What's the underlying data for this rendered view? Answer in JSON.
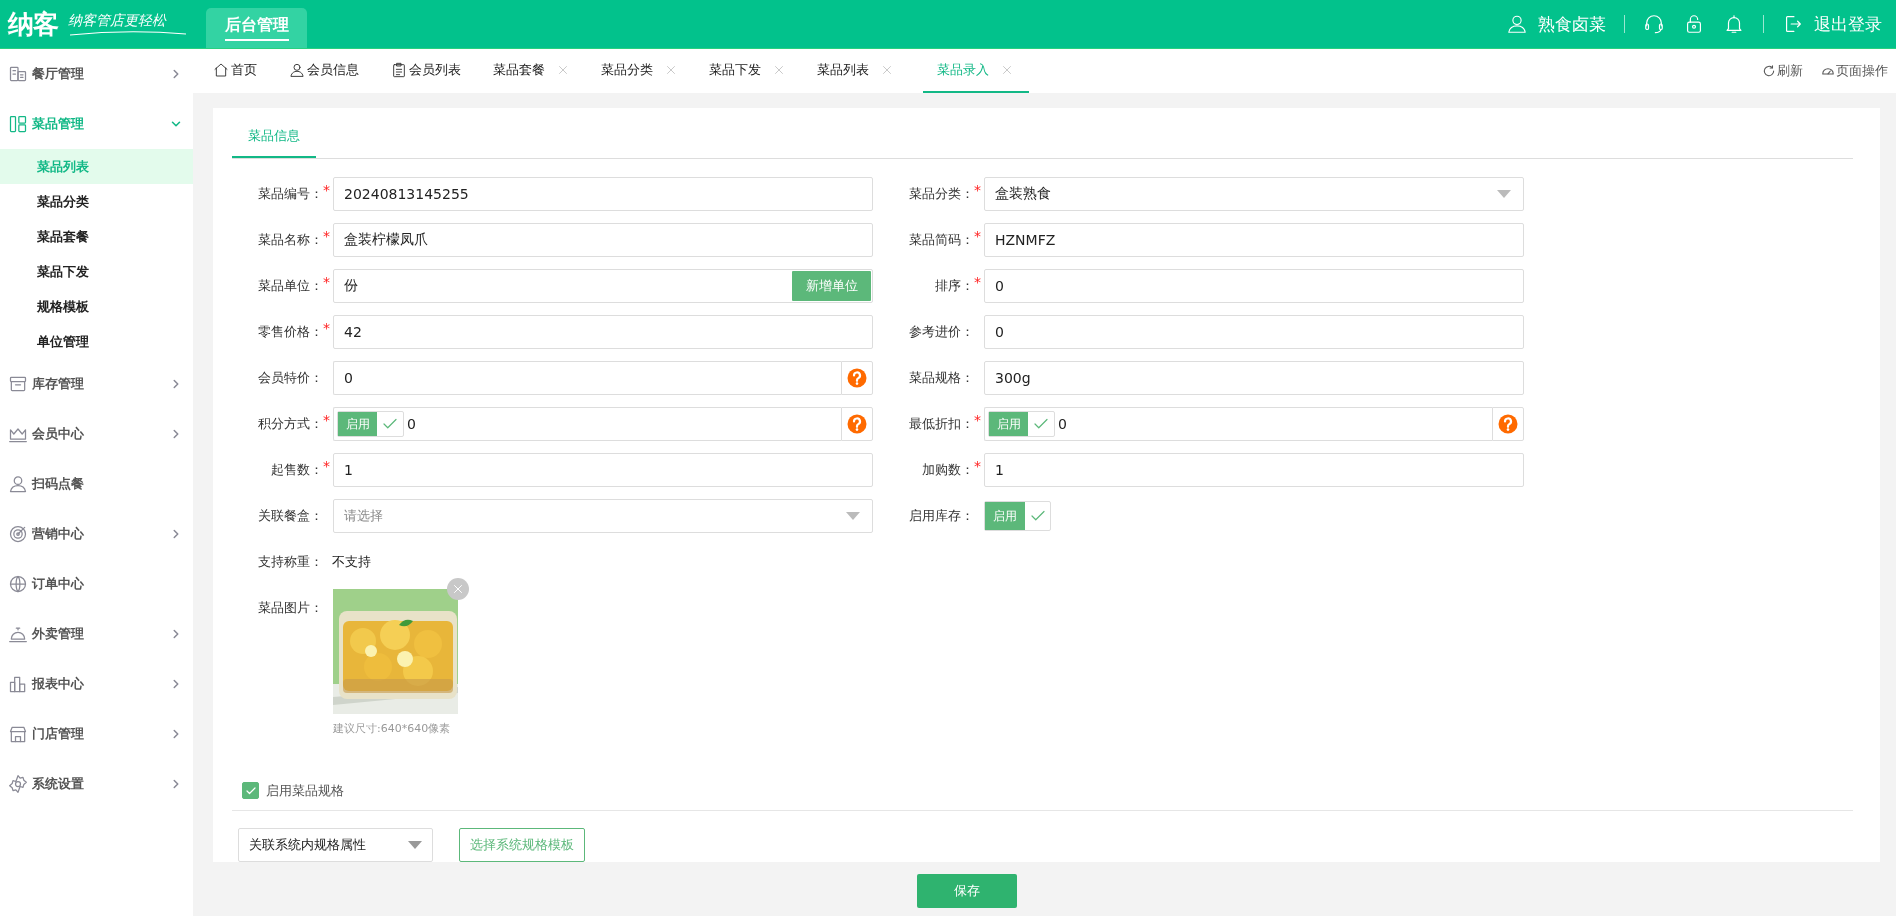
{
  "header": {
    "logo": "纳客",
    "slogan": "纳客管店更轻松",
    "module_tab": {
      "label": "后台管理",
      "selected": true
    },
    "user": "熟食卤菜",
    "logout": "退出登录"
  },
  "sidebar": {
    "items": [
      {
        "label": "餐厅管理",
        "expandable": true,
        "expanded": false
      },
      {
        "label": "菜品管理",
        "expandable": true,
        "expanded": true,
        "children": [
          {
            "label": "菜品列表",
            "selected": true
          },
          {
            "label": "菜品分类",
            "selected": false
          },
          {
            "label": "菜品套餐",
            "selected": false
          },
          {
            "label": "菜品下发",
            "selected": false
          },
          {
            "label": "规格模板",
            "selected": false
          },
          {
            "label": "单位管理",
            "selected": false
          }
        ]
      },
      {
        "label": "库存管理",
        "expandable": true,
        "expanded": false
      },
      {
        "label": "会员中心",
        "expandable": true,
        "expanded": false
      },
      {
        "label": "扫码点餐",
        "expandable": false
      },
      {
        "label": "营销中心",
        "expandable": true,
        "expanded": false
      },
      {
        "label": "订单中心",
        "expandable": false
      },
      {
        "label": "外卖管理",
        "expandable": true,
        "expanded": false
      },
      {
        "label": "报表中心",
        "expandable": true,
        "expanded": false
      },
      {
        "label": "门店管理",
        "expandable": true,
        "expanded": false
      },
      {
        "label": "系统设置",
        "expandable": true,
        "expanded": false
      }
    ]
  },
  "tabs": [
    {
      "label": "首页",
      "closable": false,
      "selected": false
    },
    {
      "label": "会员信息",
      "closable": false,
      "selected": false
    },
    {
      "label": "会员列表",
      "closable": false,
      "selected": false
    },
    {
      "label": "菜品套餐",
      "closable": true,
      "selected": false
    },
    {
      "label": "菜品分类",
      "closable": true,
      "selected": false
    },
    {
      "label": "菜品下发",
      "closable": true,
      "selected": false
    },
    {
      "label": "菜品列表",
      "closable": true,
      "selected": false
    },
    {
      "label": "菜品录入",
      "closable": true,
      "selected": true
    }
  ],
  "tab_actions": [
    {
      "label": "刷新"
    },
    {
      "label": "页面操作"
    }
  ],
  "form": {
    "section_tab": {
      "label": "菜品信息",
      "selected": true
    },
    "rows": [
      [
        {
          "label": "菜品编号：",
          "required_mark": "*",
          "kind": "text",
          "value": "20240813145255"
        },
        {
          "label": "菜品分类：",
          "required_mark": "*",
          "kind": "select",
          "value": "盒装熟食"
        }
      ],
      [
        {
          "label": "菜品名称：",
          "required_mark": "*",
          "kind": "text",
          "value": "盒装柠檬凤爪"
        },
        {
          "label": "菜品简码：",
          "required_mark": "*",
          "kind": "text",
          "value": "HZNMFZ"
        }
      ],
      [
        {
          "label": "菜品单位：",
          "required_mark": "*",
          "kind": "text_button",
          "value": "份",
          "button": "新增单位"
        },
        {
          "label": "排序：",
          "required_mark": "*",
          "kind": "text",
          "value": "0"
        }
      ],
      [
        {
          "label": "零售价格：",
          "required_mark": "*",
          "kind": "text",
          "value": "42"
        },
        {
          "label": "参考进价：",
          "kind": "text",
          "value": "0"
        }
      ],
      [
        {
          "label": "会员特价：",
          "kind": "text_help",
          "value": "0"
        },
        {
          "label": "菜品规格：",
          "kind": "text",
          "value": "300g"
        }
      ],
      [
        {
          "label": "积分方式：",
          "required_mark": "*",
          "kind": "toggle_help",
          "toggle": {
            "label": "启用",
            "checked": true
          },
          "value": "0"
        },
        {
          "label": "最低折扣：",
          "required_mark": "*",
          "kind": "toggle_help",
          "toggle": {
            "label": "启用",
            "checked": true
          },
          "value": "0"
        }
      ],
      [
        {
          "label": "起售数：",
          "required_mark": "*",
          "kind": "text",
          "value": "1"
        },
        {
          "label": "加购数：",
          "required_mark": "*",
          "kind": "text",
          "value": "1"
        }
      ],
      [
        {
          "label": "关联餐盒：",
          "kind": "select",
          "placeholder": "请选择"
        },
        {
          "label": "启用库存：",
          "kind": "toggle",
          "toggle": {
            "label": "启用",
            "checked": true
          }
        }
      ]
    ],
    "weighing": {
      "label": "支持称重：",
      "value": "不支持"
    },
    "image": {
      "label": "菜品图片：",
      "hint": "建议尺寸:640*640像素"
    },
    "spec": {
      "checkbox": {
        "label": "启用菜品规格",
        "checked": true
      },
      "select": "关联系统内规格属性",
      "template_button": "选择系统规格模板"
    },
    "save_button": "保存"
  }
}
